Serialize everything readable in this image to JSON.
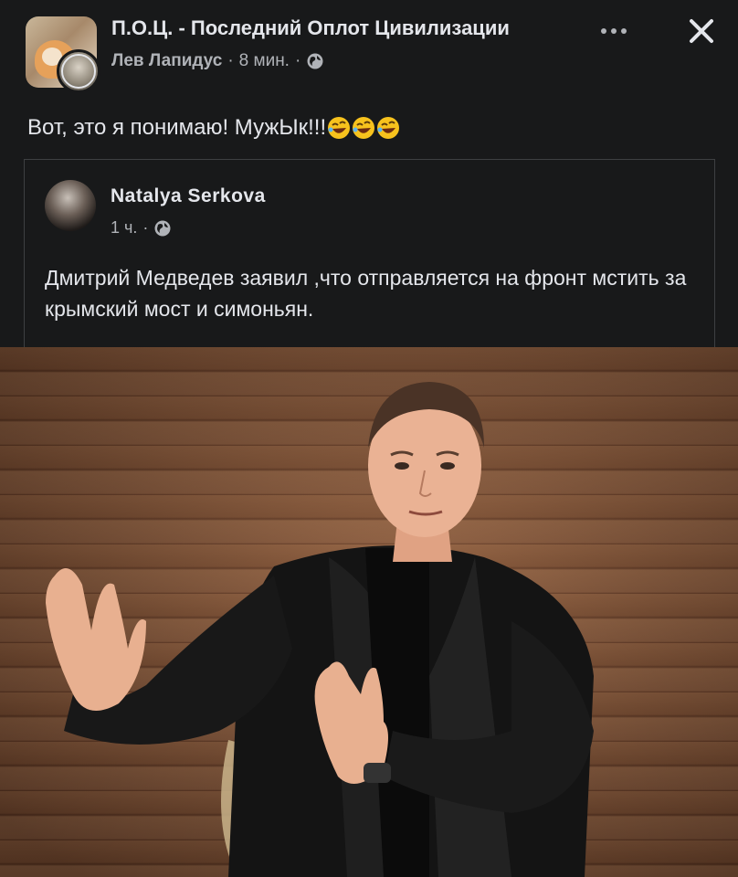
{
  "header": {
    "group_title": "П.О.Ц. - Последний Оплот Цивилизации",
    "author": "Лев Лапидус",
    "separator": "·",
    "time": "8 мин.",
    "separator2": "·",
    "more_icon": "more-horizontal-icon",
    "close_icon": "close-icon",
    "privacy_icon": "globe-icon"
  },
  "post": {
    "text": "Вот, это я понимаю! МужЫк!!!",
    "emoji": [
      "rolling-laughing-emoji",
      "rolling-laughing-emoji",
      "rolling-laughing-emoji"
    ]
  },
  "shared": {
    "author": "Natalya  Serkova",
    "time": "1 ч.",
    "separator": "·",
    "privacy_icon": "globe-icon",
    "text": "Дмитрий Медведев заявил ,что отправляется на фронт мстить за крымский мост и симоньян."
  },
  "photo": {
    "description_icon": "photo-of-man-in-leather-jacket"
  },
  "colors": {
    "background": "#18191a",
    "text_primary": "#e4e6eb",
    "text_secondary": "#b0b3b8",
    "border": "#3e4042"
  }
}
